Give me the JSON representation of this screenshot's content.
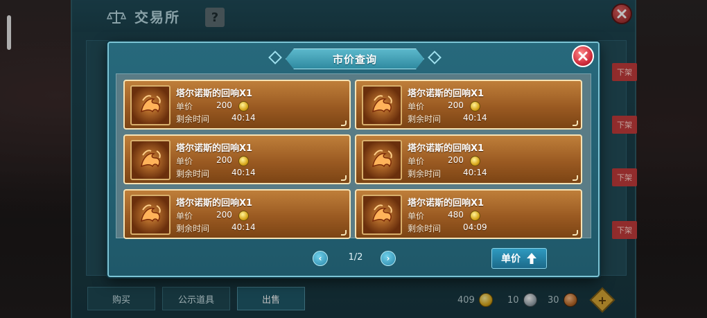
{
  "exchange": {
    "title": "交易所",
    "help": "?",
    "side_buttons": [
      "下架",
      "下架",
      "下架",
      "下架"
    ],
    "tabs": [
      {
        "label": "购买"
      },
      {
        "label": "公示道具"
      },
      {
        "label": "出售"
      }
    ],
    "currencies": [
      {
        "amount": "409",
        "icon": "gold-coin-icon"
      },
      {
        "amount": "10",
        "icon": "silver-coin-icon"
      },
      {
        "amount": "30",
        "icon": "bronze-coin-icon"
      }
    ],
    "add_icon": "+"
  },
  "modal": {
    "title": "市价查询",
    "price_label": "单价",
    "time_label": "剩余时间",
    "items": [
      {
        "name": "塔尔诺斯的回响X1",
        "price": "200",
        "time": "40:14"
      },
      {
        "name": "塔尔诺斯的回响X1",
        "price": "200",
        "time": "40:14"
      },
      {
        "name": "塔尔诺斯的回响X1",
        "price": "200",
        "time": "40:14"
      },
      {
        "name": "塔尔诺斯的回响X1",
        "price": "200",
        "time": "40:14"
      },
      {
        "name": "塔尔诺斯的回响X1",
        "price": "200",
        "time": "40:14"
      },
      {
        "name": "塔尔诺斯的回响X1",
        "price": "480",
        "time": "04:09"
      }
    ],
    "pager": {
      "text": "1/2",
      "prev": "‹",
      "next": "›"
    },
    "sort_button": "单价"
  }
}
